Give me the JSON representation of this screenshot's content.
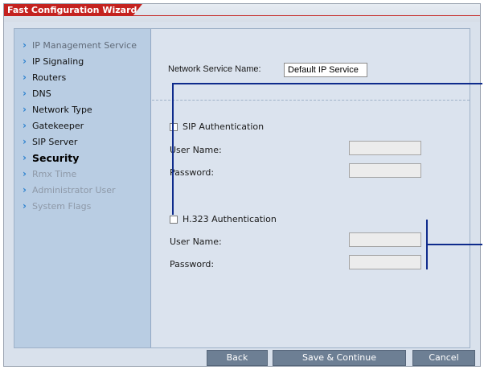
{
  "window": {
    "title": "Fast Configuration Wizard"
  },
  "sidebar": {
    "items": [
      {
        "label": "IP Management Service",
        "state": "visited"
      },
      {
        "label": "IP Signaling",
        "state": "normal"
      },
      {
        "label": "Routers",
        "state": "normal"
      },
      {
        "label": "DNS",
        "state": "normal"
      },
      {
        "label": "Network Type",
        "state": "normal"
      },
      {
        "label": "Gatekeeper",
        "state": "normal"
      },
      {
        "label": "SIP Server",
        "state": "normal"
      },
      {
        "label": "Security",
        "state": "current"
      },
      {
        "label": "Rmx Time",
        "state": "disabled"
      },
      {
        "label": "Administrator User",
        "state": "disabled"
      },
      {
        "label": "System Flags",
        "state": "disabled"
      }
    ]
  },
  "main": {
    "network_service_label": "Network Service Name:",
    "network_service_value": "Default IP Service",
    "sip": {
      "checkbox_label": "SIP Authentication",
      "checked": false,
      "user_label": "User Name:",
      "password_label": "Password:",
      "user_value": "",
      "password_value": ""
    },
    "h323": {
      "checkbox_label": "H.323 Authentication",
      "checked": false,
      "user_label": "User Name:",
      "password_label": "Password:",
      "user_value": "",
      "password_value": ""
    }
  },
  "footer": {
    "back_label": "Back",
    "save_label": "Save & Continue",
    "cancel_label": "Cancel"
  },
  "colors": {
    "title_tab": "#c4221f",
    "sidebar_bg": "#b9cde3",
    "content_bg": "#dbe3ee",
    "button_bg": "#6d7f94",
    "nav_chevron": "#2f83cf",
    "callout": "#0e2b8c"
  },
  "icons": {
    "nav_chevron": "chevron-right-icon"
  }
}
